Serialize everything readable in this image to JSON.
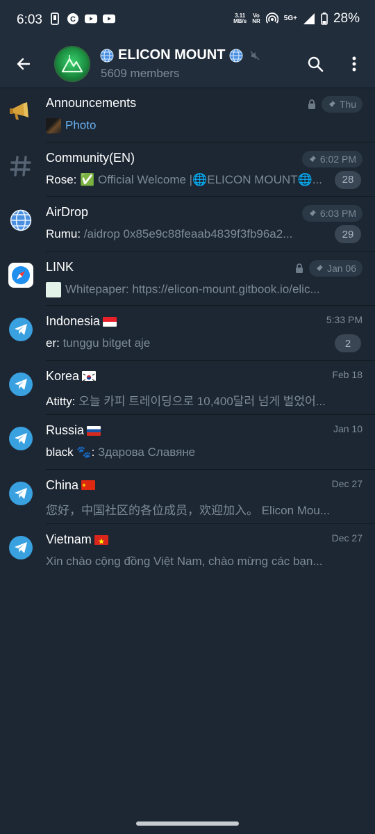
{
  "status_bar": {
    "time": "6:03",
    "data_speed_value": "3.11",
    "data_speed_unit": "MB/s",
    "volte_top": "Vo",
    "volte_bottom": "NR",
    "network": "5G+",
    "battery": "28%"
  },
  "header": {
    "title": "ELICON MOUNT",
    "subtitle": "5609 members",
    "accent_color": "#6ab2f2"
  },
  "topics": [
    {
      "name": "Announcements",
      "icon": "megaphone-icon",
      "locked": true,
      "pinned": true,
      "date": "Thu",
      "sender": "",
      "preview": "Photo",
      "preview_accent": true,
      "unread": ""
    },
    {
      "name": "Community(EN)",
      "icon": "hash-icon",
      "locked": false,
      "pinned": true,
      "date": "6:02 PM",
      "sender": "Rose: ",
      "preview": "✅ Official Welcome |🌐ELICON MOUNT🌐...",
      "unread": "28"
    },
    {
      "name": "AirDrop",
      "icon": "globe-icon",
      "locked": false,
      "pinned": true,
      "date": "6:03 PM",
      "sender": "Rumu: ",
      "preview": "/aidrop 0x85e9c88feaab4839f3fb96a2...",
      "unread": "29"
    },
    {
      "name": "LINK",
      "icon": "compass-icon",
      "locked": true,
      "pinned": true,
      "date": "Jan 06",
      "sender": "",
      "preview": "Whitepaper: https://elicon-mount.gitbook.io/elic...",
      "unread": ""
    },
    {
      "name": "Indonesia",
      "flag": "id",
      "icon": "telegram-icon",
      "date": "5:33 PM",
      "sender": "er: ",
      "preview": "tunggu bitget aje",
      "unread": "2"
    },
    {
      "name": "Korea",
      "flag": "kr",
      "icon": "telegram-icon",
      "date": "Feb 18",
      "sender": "Atitty: ",
      "preview": "오늘 카피 트레이딩으로 10,400달러 넘게 벌었어...",
      "unread": ""
    },
    {
      "name": "Russia",
      "flag": "ru",
      "icon": "telegram-icon",
      "date": "Jan 10",
      "sender": "black 🐾: ",
      "preview": "Здарова Славяне",
      "unread": ""
    },
    {
      "name": "China",
      "flag": "cn",
      "icon": "telegram-icon",
      "date": "Dec 27",
      "sender": "",
      "preview": "您好，中国社区的各位成员，欢迎加入。 Elicon Mou...",
      "unread": ""
    },
    {
      "name": "Vietnam",
      "flag": "vn",
      "icon": "telegram-icon",
      "date": "Dec 27",
      "sender": "",
      "preview": "Xin chào cộng đồng Việt Nam, chào mừng các bạn...",
      "unread": ""
    }
  ]
}
